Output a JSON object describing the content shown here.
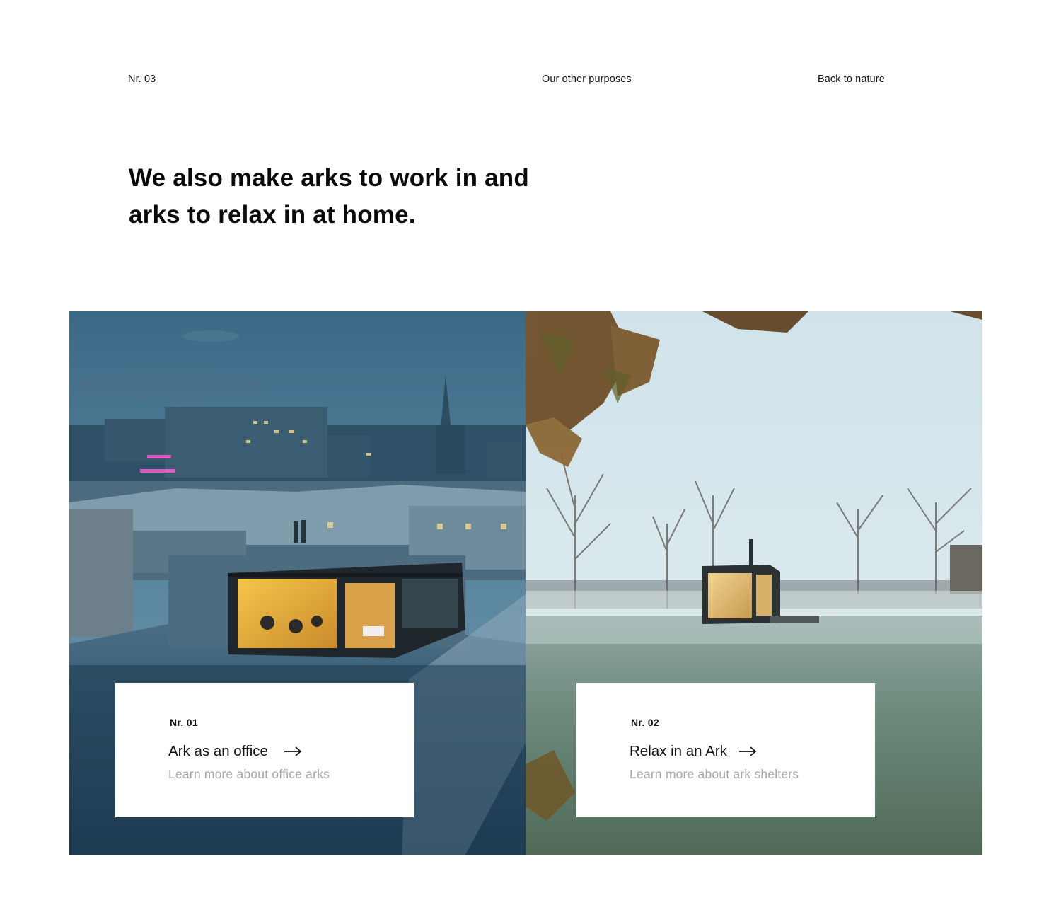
{
  "header": {
    "section_number": "Nr. 03",
    "other_purposes_link": "Our other purposes",
    "back_link": "Back to nature"
  },
  "headline": {
    "line1": "We also make arks to work in and",
    "line2": "arks to relax in at home."
  },
  "cards": [
    {
      "number": "Nr. 01",
      "title": "Ark as an office",
      "subtitle": "Learn more about office arks",
      "arrow_icon": "arrow-right-icon",
      "photo": "rooftop-office-ark-dusk-city"
    },
    {
      "number": "Nr. 02",
      "title": "Relax in an Ark",
      "subtitle": "Learn more about ark shelters",
      "arrow_icon": "arrow-right-icon",
      "photo": "ark-cabin-misty-meadow"
    }
  ],
  "colors": {
    "text": "#0d0d0d",
    "muted": "#a7a7a7",
    "background": "#ffffff"
  }
}
